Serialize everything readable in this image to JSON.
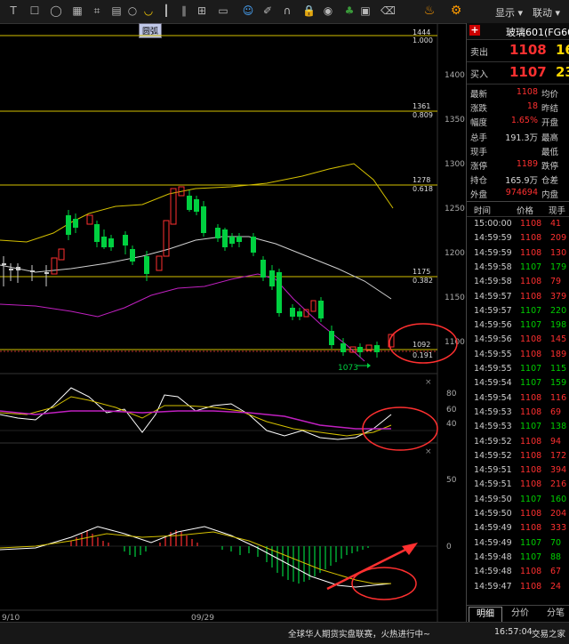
{
  "toolbar": {
    "tooltip": "圆弧",
    "menu_display": "显示 ▾",
    "menu_link": "联动 ▾"
  },
  "chart": {
    "price_axis": [
      "1400",
      "1350",
      "1300",
      "1250",
      "1200",
      "1150",
      "1100"
    ],
    "fib_levels": [
      {
        "price": "1444",
        "ratio": "1.000"
      },
      {
        "price": "1361",
        "ratio": "0.809"
      },
      {
        "price": "1278",
        "ratio": "0.618"
      },
      {
        "price": "1175",
        "ratio": "0.382"
      },
      {
        "price": "1092",
        "ratio": "0.191"
      }
    ],
    "low_label": "1073",
    "kdj_axis": [
      "80",
      "60",
      "40"
    ],
    "macd_axis": [
      "50",
      "0"
    ],
    "dates": [
      "9/10",
      "09/29"
    ]
  },
  "panel": {
    "title": "玻璃601(FG60",
    "ask_label": "卖出",
    "ask_price": "1108",
    "ask_vol": "16",
    "bid_label": "买入",
    "bid_price": "1107",
    "bid_vol": "23",
    "quotes": [
      {
        "l": "最新",
        "v": "1108",
        "l2": "均价",
        "c": "#ff3030"
      },
      {
        "l": "涨跌",
        "v": "18",
        "l2": "昨结",
        "c": "#ff3030"
      },
      {
        "l": "幅度",
        "v": "1.65%",
        "l2": "开盘",
        "c": "#ff3030"
      },
      {
        "l": "总手",
        "v": "191.3万",
        "l2": "最高",
        "c": "#d8d8d8"
      },
      {
        "l": "现手",
        "v": "",
        "l2": "最低",
        "c": "#d8d8d8"
      },
      {
        "l": "涨停",
        "v": "1189",
        "l2": "跌停",
        "c": "#ff3030"
      },
      {
        "l": "持仓",
        "v": "165.9万",
        "l2": "仓差",
        "c": "#d8d8d8"
      },
      {
        "l": "外盘",
        "v": "974694",
        "l2": "内盘",
        "c": "#ff3030"
      }
    ],
    "tick_header": [
      "时间",
      "价格",
      "现手"
    ],
    "ticks": [
      {
        "t": "15:00:00",
        "p": "1108",
        "q": "41",
        "c": "#ff3030"
      },
      {
        "t": "14:59:59",
        "p": "1108",
        "q": "209",
        "c": "#ff3030"
      },
      {
        "t": "14:59:59",
        "p": "1108",
        "q": "130",
        "c": "#ff3030"
      },
      {
        "t": "14:59:58",
        "p": "1107",
        "q": "179",
        "c": "#00d000"
      },
      {
        "t": "14:59:58",
        "p": "1108",
        "q": "79",
        "c": "#ff3030"
      },
      {
        "t": "14:59:57",
        "p": "1108",
        "q": "379",
        "c": "#ff3030"
      },
      {
        "t": "14:59:57",
        "p": "1107",
        "q": "220",
        "c": "#00d000"
      },
      {
        "t": "14:59:56",
        "p": "1107",
        "q": "198",
        "c": "#00d000"
      },
      {
        "t": "14:59:56",
        "p": "1108",
        "q": "145",
        "c": "#ff3030"
      },
      {
        "t": "14:59:55",
        "p": "1108",
        "q": "189",
        "c": "#ff3030"
      },
      {
        "t": "14:59:55",
        "p": "1107",
        "q": "115",
        "c": "#00d000"
      },
      {
        "t": "14:59:54",
        "p": "1107",
        "q": "159",
        "c": "#00d000"
      },
      {
        "t": "14:59:54",
        "p": "1108",
        "q": "116",
        "c": "#ff3030"
      },
      {
        "t": "14:59:53",
        "p": "1108",
        "q": "69",
        "c": "#ff3030"
      },
      {
        "t": "14:59:53",
        "p": "1107",
        "q": "138",
        "c": "#00d000"
      },
      {
        "t": "14:59:52",
        "p": "1108",
        "q": "94",
        "c": "#ff3030"
      },
      {
        "t": "14:59:52",
        "p": "1108",
        "q": "172",
        "c": "#ff3030"
      },
      {
        "t": "14:59:51",
        "p": "1108",
        "q": "394",
        "c": "#ff3030"
      },
      {
        "t": "14:59:51",
        "p": "1108",
        "q": "216",
        "c": "#ff3030"
      },
      {
        "t": "14:59:50",
        "p": "1107",
        "q": "160",
        "c": "#00d000"
      },
      {
        "t": "14:59:50",
        "p": "1108",
        "q": "204",
        "c": "#ff3030"
      },
      {
        "t": "14:59:49",
        "p": "1108",
        "q": "333",
        "c": "#ff3030"
      },
      {
        "t": "14:59:49",
        "p": "1107",
        "q": "70",
        "c": "#00d000"
      },
      {
        "t": "14:59:48",
        "p": "1107",
        "q": "88",
        "c": "#00d000"
      },
      {
        "t": "14:59:48",
        "p": "1108",
        "q": "67",
        "c": "#ff3030"
      },
      {
        "t": "14:59:47",
        "p": "1108",
        "q": "24",
        "c": "#ff3030"
      }
    ],
    "tabs": [
      "明细",
      "分价",
      "分笔"
    ]
  },
  "status": {
    "ticker": "全球华人期货实盘联赛，火热进行中~",
    "time": "16:57:04",
    "watermark": "交易之家"
  }
}
